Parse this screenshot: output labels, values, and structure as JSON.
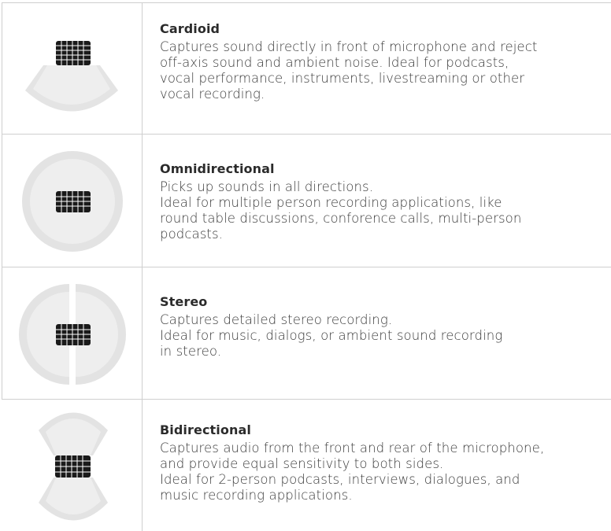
{
  "patterns": [
    {
      "title": "Cardioid",
      "lines": [
        "Captures sound directly in front of microphone and reject",
        "off-axis sound and ambient noise. Ideal for podcasts,",
        "vocal performance, instruments, livestreaming or other",
        "vocal recording."
      ],
      "icon": "cardioid-pattern-icon"
    },
    {
      "title": "Omnidirectional",
      "lines": [
        "Picks up sounds in all directions.",
        "Ideal for multiple person recording applications, like",
        "round table discussions, conforence calls, multi-person",
        "podcasts."
      ],
      "icon": "omnidirectional-pattern-icon"
    },
    {
      "title": "Stereo",
      "lines": [
        "Captures detailed stereo recording.",
        "Ideal for music, dialogs, or ambient sound recording",
        "in stereo."
      ],
      "icon": "stereo-pattern-icon"
    },
    {
      "title": "Bidirectional",
      "lines": [
        "Captures audio from the front and rear of the microphone,",
        "and provide equal sensitivity to both sides.",
        "Ideal for 2-person podcasts, interviews, dialogues, and",
        "music recording applications."
      ],
      "icon": "bidirectional-pattern-icon"
    }
  ],
  "colors": {
    "pattern_outer": "#e6e6e6",
    "pattern_inner": "#ececec",
    "mic_grille": "#1a1a1a",
    "grid_line": "#cfcfcf"
  }
}
